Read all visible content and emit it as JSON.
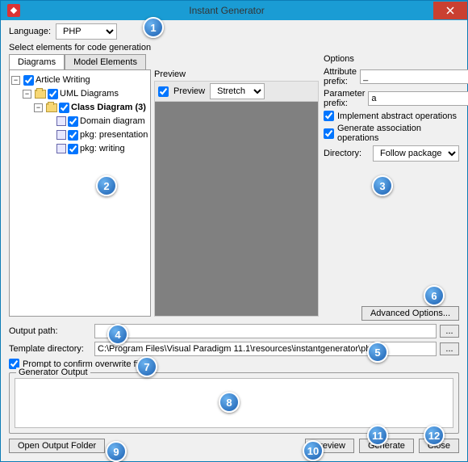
{
  "window": {
    "title": "Instant Generator"
  },
  "language": {
    "label": "Language:",
    "value": "PHP"
  },
  "select_elements_label": "Select elements for code generation",
  "tabs": {
    "diagrams": "Diagrams",
    "model_elements": "Model Elements"
  },
  "tree": {
    "article_writing": "Article Writing",
    "uml": "UML Diagrams",
    "class_diagram": "Class Diagram (3)",
    "domain": "Domain diagram",
    "pkg_presentation": "pkg: presentation",
    "pkg_writing": "pkg: writing"
  },
  "preview": {
    "label": "Preview",
    "checkbox": "Preview",
    "stretch": "Stretch"
  },
  "options": {
    "header": "Options",
    "attr_prefix_label": "Attribute prefix:",
    "attr_prefix_value": "_",
    "param_prefix_label": "Parameter prefix:",
    "param_prefix_value": "a",
    "impl_abstract": "Implement abstract operations",
    "gen_assoc": "Generate association operations",
    "directory_label": "Directory:",
    "directory_value": "Follow package",
    "advanced": "Advanced Options..."
  },
  "output_path": {
    "label": "Output path:",
    "value": ""
  },
  "template_dir": {
    "label": "Template directory:",
    "value": "C:\\Program Files\\Visual Paradigm 11.1\\resources\\instantgenerator\\php"
  },
  "prompt_overwrite": "Prompt to confirm overwrite file",
  "gen_output_label": "Generator Output",
  "buttons": {
    "open_output": "Open Output Folder",
    "preview": "Preview",
    "generate": "Generate",
    "close": "Close",
    "browse": "..."
  },
  "callouts": [
    "1",
    "2",
    "3",
    "4",
    "5",
    "6",
    "7",
    "8",
    "9",
    "10",
    "11",
    "12"
  ]
}
